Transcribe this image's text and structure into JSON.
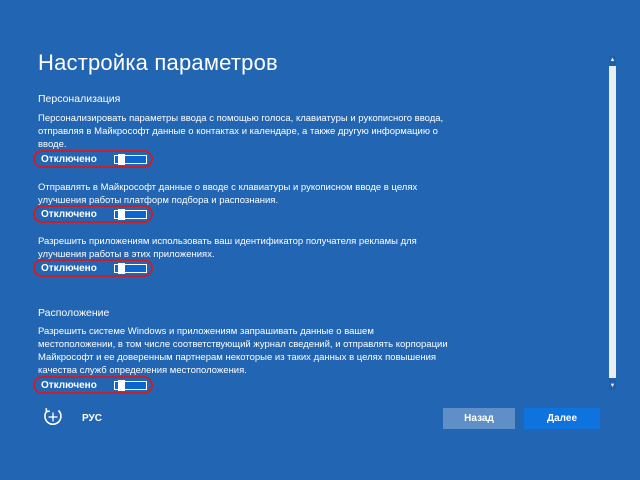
{
  "page": {
    "title": "Настройка параметров"
  },
  "sections": {
    "personalization": {
      "heading": "Персонализация",
      "settings": [
        {
          "description": "Персонализировать параметры ввода с помощью голоса, клавиатуры и рукописного ввода, отправляя в Майкрософт данные о контактах и календаре, а также другую информацию о вводе.",
          "toggle_label": "Отключено",
          "enabled": false
        },
        {
          "description": "Отправлять в Майкрософт данные о вводе с клавиатуры и рукописном вводе в целях улучшения работы платформ подбора и распознания.",
          "toggle_label": "Отключено",
          "enabled": false
        },
        {
          "description": "Разрешить приложениям использовать ваш идентификатор получателя рекламы для улучшения работы в этих приложениях.",
          "toggle_label": "Отключено",
          "enabled": false
        }
      ]
    },
    "location": {
      "heading": "Расположение",
      "settings": [
        {
          "description": "Разрешить системе Windows и приложениям запрашивать данные о вашем местоположении, в том числе соответствующий журнал сведений, и отправлять корпорации Майкрософт и ее доверенным партнерам некоторые из таких данных в целях повышения качества служб определения местоположения.",
          "toggle_label": "Отключено",
          "enabled": false
        }
      ]
    }
  },
  "footer": {
    "accessibility_icon": "ease-of-access-icon",
    "language": "РУС",
    "back_label": "Назад",
    "next_label": "Далее"
  },
  "colors": {
    "background": "#2265b3",
    "highlight_outline": "#c8202a",
    "toggle_fill": "#0b67cf",
    "back_button": "#5f8fc6",
    "next_button": "#0f73dd"
  }
}
